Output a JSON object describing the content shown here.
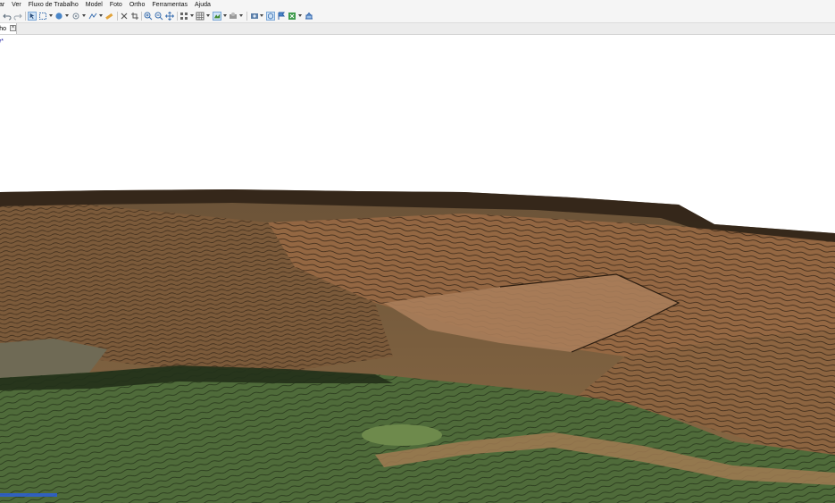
{
  "menu": {
    "items": [
      "tar",
      "Ver",
      "Fluxo de Trabalho",
      "Model",
      "Foto",
      "Ortho",
      "Ferramentas",
      "Ajuda"
    ]
  },
  "toolbar": {
    "icons": [
      "undo-icon",
      "redo-icon",
      "navigation-icon",
      "rect-selection-icon",
      "circle-selection-icon",
      "rotate-object-icon",
      "draw-polyline-icon",
      "ruler-icon",
      "delete-icon",
      "crop-icon",
      "zoom-in-icon",
      "zoom-out-icon",
      "move-icon",
      "grid-icon",
      "table-icon",
      "model-view-icon",
      "texture-icon",
      "photo-icon",
      "shapes-icon",
      "flag-icon",
      "layout-icon",
      "export-icon"
    ]
  },
  "tab": {
    "label": "rtho",
    "close_icon": "close-icon"
  },
  "viewport": {
    "label": "g*"
  },
  "colors": {
    "terrain_light": "#8a6a45",
    "terrain_dark": "#3a2a1c",
    "vegetation": "#4f6b3a",
    "accent_selected": "#cfe3f7"
  }
}
